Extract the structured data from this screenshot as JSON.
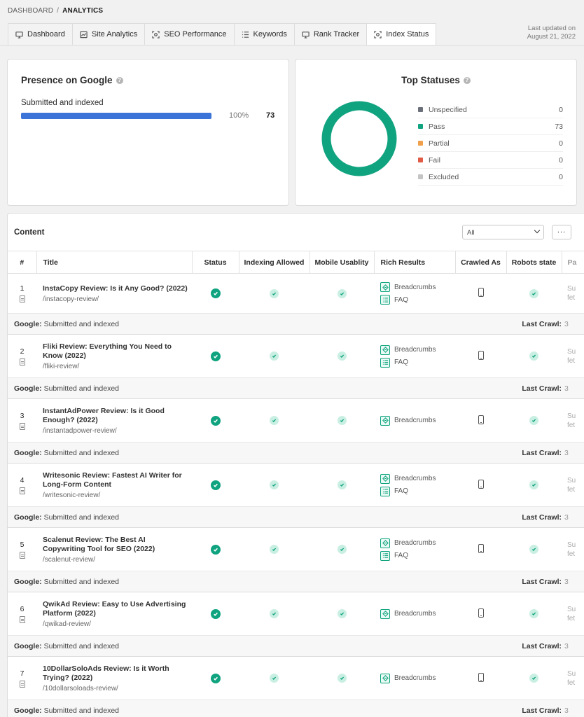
{
  "breadcrumb": {
    "root": "DASHBOARD",
    "separator": "/",
    "current": "ANALYTICS"
  },
  "tabs": [
    {
      "label": "Dashboard",
      "icon": "monitor-icon",
      "active": false
    },
    {
      "label": "Site Analytics",
      "icon": "chart-icon",
      "active": false
    },
    {
      "label": "SEO Performance",
      "icon": "target-icon",
      "active": false
    },
    {
      "label": "Keywords",
      "icon": "list-icon",
      "active": false
    },
    {
      "label": "Rank Tracker",
      "icon": "monitor-icon",
      "active": false
    },
    {
      "label": "Index Status",
      "icon": "target-icon",
      "active": true
    }
  ],
  "last_updated": {
    "label": "Last updated on",
    "date": "August 21, 2022"
  },
  "presence": {
    "title": "Presence on Google",
    "help": "?",
    "bar_label": "Submitted and indexed",
    "percent_text": "100%",
    "fill_fraction": 1.0,
    "count": "73",
    "bar_color": "#3b73d8"
  },
  "top_statuses": {
    "title": "Top Statuses",
    "help": "?",
    "donut_color": "#10a37f",
    "items": [
      {
        "label": "Unspecified",
        "value": "0",
        "color": "#6b6f7a"
      },
      {
        "label": "Pass",
        "value": "73",
        "color": "#10a37f"
      },
      {
        "label": "Partial",
        "value": "0",
        "color": "#f0a04b"
      },
      {
        "label": "Fail",
        "value": "0",
        "color": "#e05a46"
      },
      {
        "label": "Excluded",
        "value": "0",
        "color": "#c4c4c4"
      }
    ]
  },
  "content": {
    "title": "Content",
    "filter_value": "All",
    "more_label": "...",
    "columns": [
      "#",
      "Title",
      "Status",
      "Indexing Allowed",
      "Mobile Usablity",
      "Rich Results",
      "Crawled As",
      "Robots state",
      "Pa"
    ],
    "google_label": "Google:",
    "google_status": "Submitted and indexed",
    "last_crawl_label": "Last Crawl:",
    "last_crawl_fragment": "3",
    "partial_text": "Su fet",
    "rows": [
      {
        "num": "1",
        "title": "InstaCopy Review: Is it Any Good? (2022)",
        "slug": "/instacopy-review/",
        "rich": [
          "Breadcrumbs",
          "FAQ"
        ]
      },
      {
        "num": "2",
        "title": "Fliki Review: Everything You Need to Know (2022)",
        "slug": "/fliki-review/",
        "rich": [
          "Breadcrumbs",
          "FAQ"
        ]
      },
      {
        "num": "3",
        "title": "InstantAdPower Review: Is it Good Enough? (2022)",
        "slug": "/instantadpower-review/",
        "rich": [
          "Breadcrumbs"
        ]
      },
      {
        "num": "4",
        "title": "Writesonic Review: Fastest AI Writer for Long-Form Content",
        "slug": "/writesonic-review/",
        "rich": [
          "Breadcrumbs",
          "FAQ"
        ]
      },
      {
        "num": "5",
        "title": "Scalenut Review: The Best AI Copywriting Tool for SEO (2022)",
        "slug": "/scalenut-review/",
        "rich": [
          "Breadcrumbs",
          "FAQ"
        ]
      },
      {
        "num": "6",
        "title": "QwikAd Review: Easy to Use Advertising Platform (2022)",
        "slug": "/qwikad-review/",
        "rich": [
          "Breadcrumbs"
        ]
      },
      {
        "num": "7",
        "title": "10DollarSoloAds Review: Is it Worth Trying? (2022)",
        "slug": "/10dollarsoloads-review/",
        "rich": [
          "Breadcrumbs"
        ]
      }
    ]
  }
}
